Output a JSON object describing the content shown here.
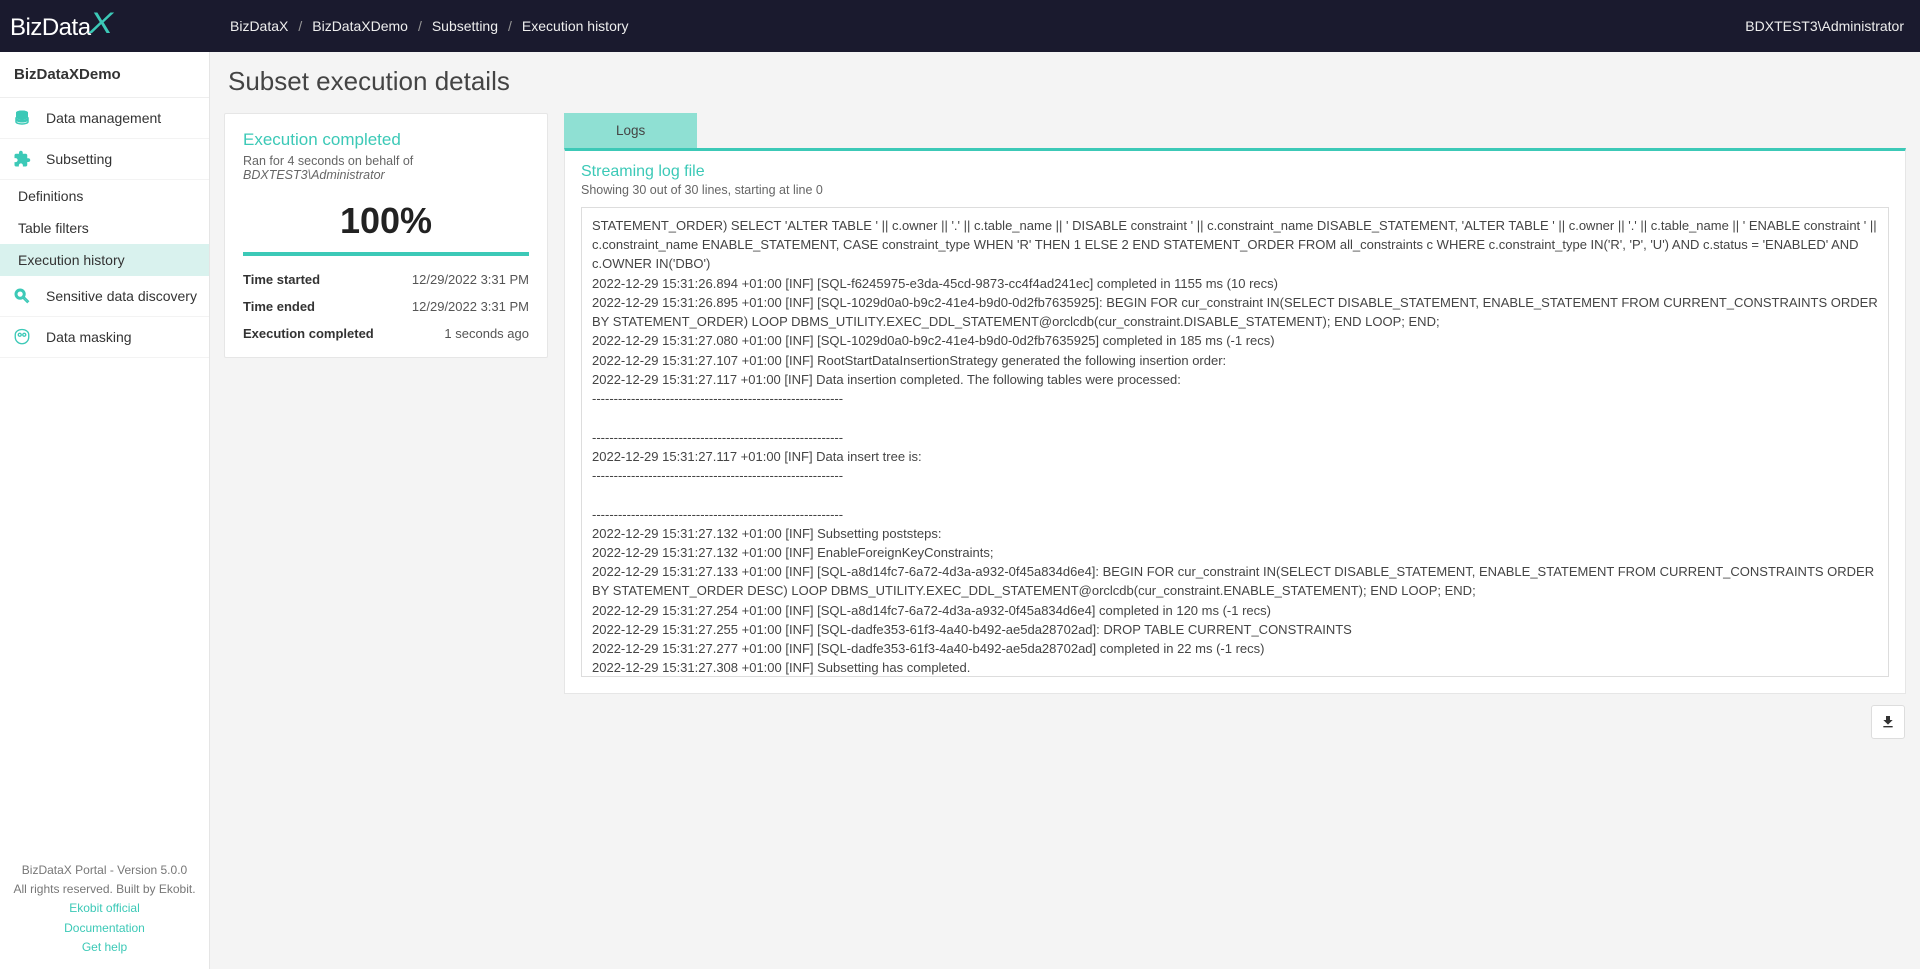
{
  "header": {
    "logo_prefix": "BizData",
    "breadcrumbs": [
      "BizDataX",
      "BizDataXDemo",
      "Subsetting",
      "Execution history"
    ],
    "user": "BDXTEST3\\Administrator"
  },
  "sidebar": {
    "project": "BizDataXDemo",
    "items": [
      {
        "label": "Data management",
        "icon": "database"
      },
      {
        "label": "Subsetting",
        "icon": "puzzle",
        "active": true,
        "children": [
          {
            "label": "Definitions"
          },
          {
            "label": "Table filters"
          },
          {
            "label": "Execution history",
            "active": true
          }
        ]
      },
      {
        "label": "Sensitive data discovery",
        "icon": "search"
      },
      {
        "label": "Data masking",
        "icon": "mask"
      }
    ]
  },
  "footer": {
    "line1": "BizDataX Portal - Version 5.0.0",
    "line2": "All rights reserved. Built by Ekobit.",
    "links": [
      "Ekobit official",
      "Documentation",
      "Get help"
    ]
  },
  "page": {
    "title": "Subset execution details"
  },
  "summary": {
    "title": "Execution completed",
    "ran_prefix": "Ran for 4 seconds on behalf of ",
    "ran_user": "BDXTEST3\\Administrator",
    "percent": "100%",
    "rows": [
      {
        "k": "Time started",
        "v": "12/29/2022 3:31 PM"
      },
      {
        "k": "Time ended",
        "v": "12/29/2022 3:31 PM"
      },
      {
        "k": "Execution completed",
        "v": "1 seconds ago"
      }
    ]
  },
  "logs": {
    "tab": "Logs",
    "title": "Streaming log file",
    "sub": "Showing 30 out of 30 lines, starting at line 0",
    "content": "STATEMENT_ORDER) SELECT 'ALTER TABLE ' || c.owner || '.' || c.table_name || ' DISABLE constraint ' || c.constraint_name DISABLE_STATEMENT, 'ALTER TABLE ' || c.owner || '.' || c.table_name || ' ENABLE constraint ' || c.constraint_name ENABLE_STATEMENT, CASE constraint_type WHEN 'R' THEN 1 ELSE 2 END STATEMENT_ORDER FROM all_constraints c WHERE c.constraint_type IN('R', 'P', 'U') AND c.status = 'ENABLED' AND c.OWNER IN('DBO')\n2022-12-29 15:31:26.894 +01:00 [INF] [SQL-f6245975-e3da-45cd-9873-cc4f4ad241ec] completed in 1155 ms (10 recs)\n2022-12-29 15:31:26.895 +01:00 [INF] [SQL-1029d0a0-b9c2-41e4-b9d0-0d2fb7635925]: BEGIN FOR cur_constraint IN(SELECT DISABLE_STATEMENT, ENABLE_STATEMENT FROM CURRENT_CONSTRAINTS ORDER BY STATEMENT_ORDER) LOOP DBMS_UTILITY.EXEC_DDL_STATEMENT@orclcdb(cur_constraint.DISABLE_STATEMENT); END LOOP; END;\n2022-12-29 15:31:27.080 +01:00 [INF] [SQL-1029d0a0-b9c2-41e4-b9d0-0d2fb7635925] completed in 185 ms (-1 recs)\n2022-12-29 15:31:27.107 +01:00 [INF] RootStartDataInsertionStrategy generated the following insertion order:\n2022-12-29 15:31:27.117 +01:00 [INF] Data insertion completed. The following tables were processed:\n----------------------------------------------------------\n\n----------------------------------------------------------\n2022-12-29 15:31:27.117 +01:00 [INF] Data insert tree is:\n----------------------------------------------------------\n\n----------------------------------------------------------\n2022-12-29 15:31:27.132 +01:00 [INF] Subsetting poststeps:\n2022-12-29 15:31:27.132 +01:00 [INF] EnableForeignKeyConstraints;\n2022-12-29 15:31:27.133 +01:00 [INF] [SQL-a8d14fc7-6a72-4d3a-a932-0f45a834d6e4]: BEGIN FOR cur_constraint IN(SELECT DISABLE_STATEMENT, ENABLE_STATEMENT FROM CURRENT_CONSTRAINTS ORDER BY STATEMENT_ORDER DESC) LOOP DBMS_UTILITY.EXEC_DDL_STATEMENT@orclcdb(cur_constraint.ENABLE_STATEMENT); END LOOP; END;\n2022-12-29 15:31:27.254 +01:00 [INF] [SQL-a8d14fc7-6a72-4d3a-a932-0f45a834d6e4] completed in 120 ms (-1 recs)\n2022-12-29 15:31:27.255 +01:00 [INF] [SQL-dadfe353-61f3-4a40-b492-ae5da28702ad]: DROP TABLE CURRENT_CONSTRAINTS\n2022-12-29 15:31:27.277 +01:00 [INF] [SQL-dadfe353-61f3-4a40-b492-ae5da28702ad] completed in 22 ms (-1 recs)\n2022-12-29 15:31:27.308 +01:00 [INF] Subsetting has completed."
  }
}
